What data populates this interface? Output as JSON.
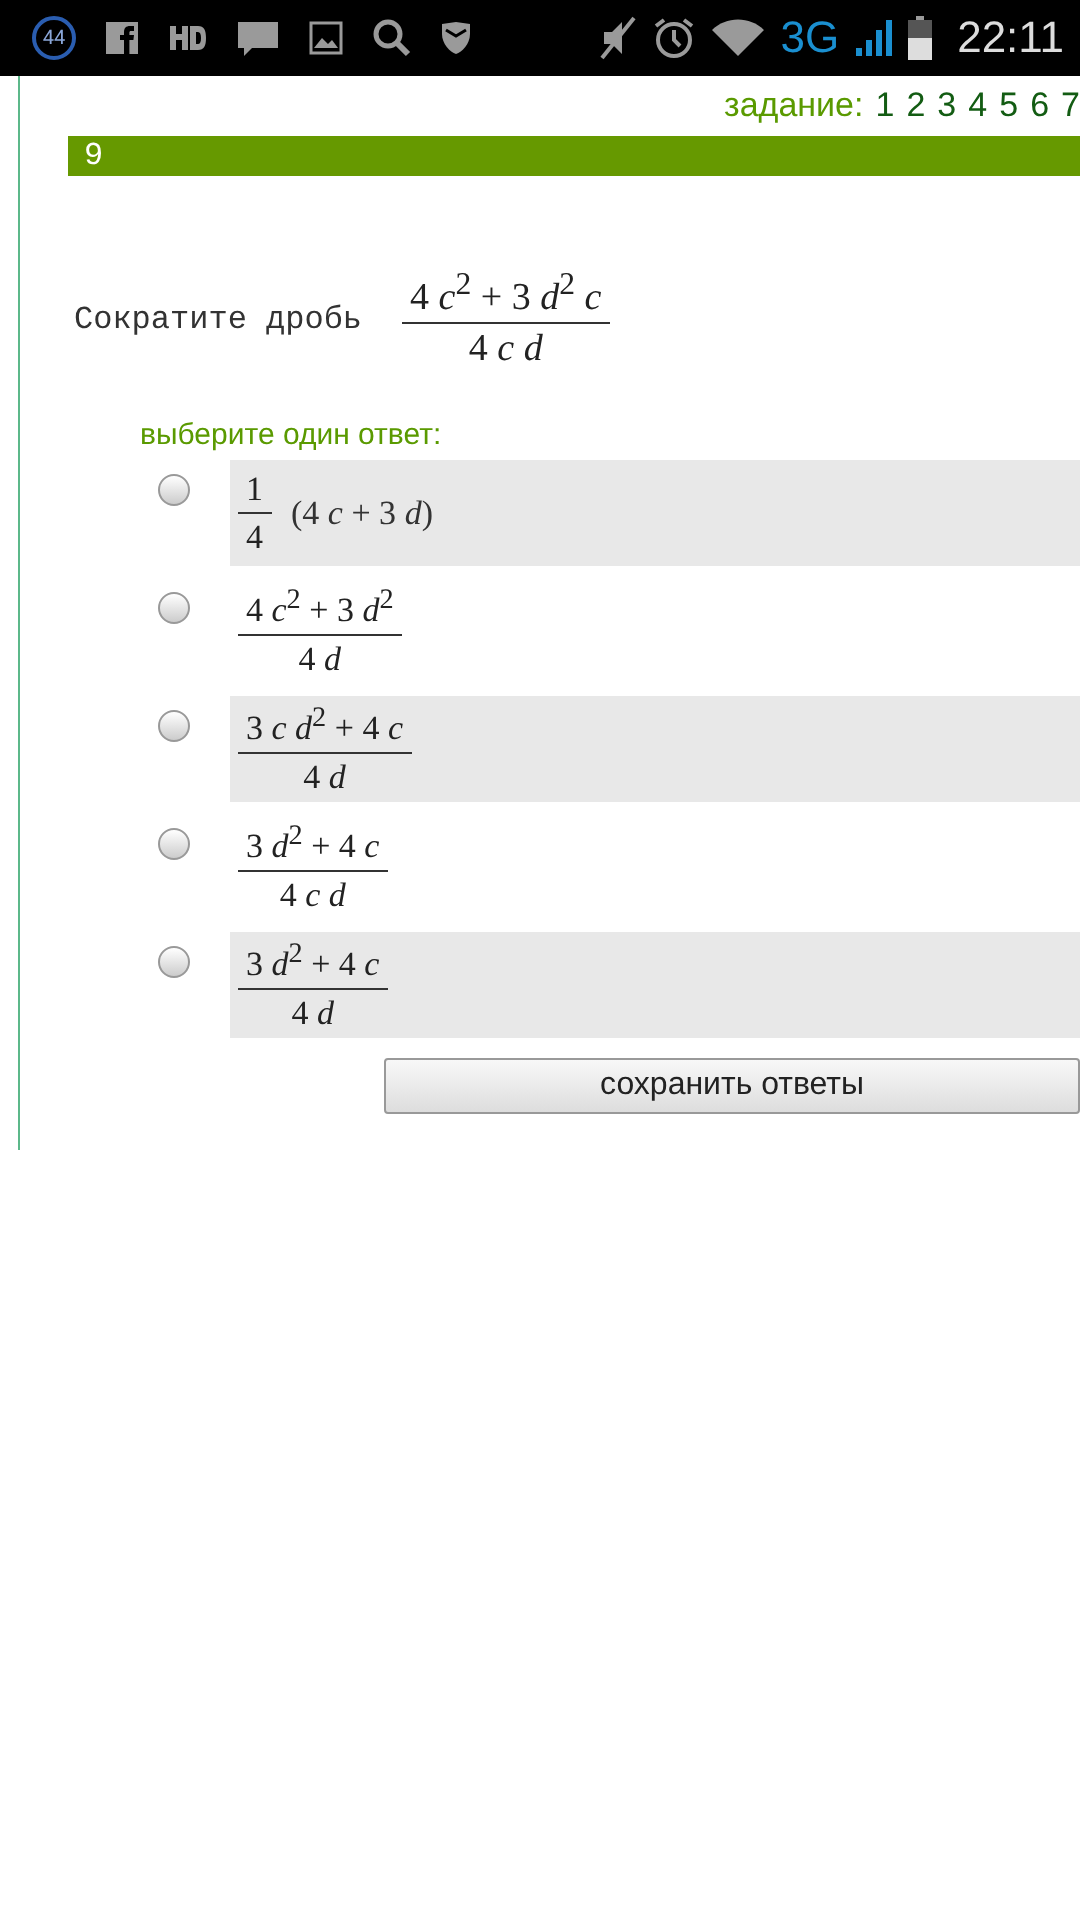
{
  "status_bar": {
    "notification_count": "44",
    "network": "3G",
    "time": "22:11"
  },
  "task_nav": {
    "label": "задание:",
    "items": [
      {
        "label": "1"
      },
      {
        "label": "2"
      },
      {
        "label": "3"
      },
      {
        "label": "4"
      },
      {
        "label": "5"
      },
      {
        "label": "6"
      },
      {
        "label": "7"
      }
    ]
  },
  "question_number": "9",
  "question": {
    "text": "Сократите дробь",
    "numerator": "4 *c*$^{2}$ + 3 *d*$^{2}$ *c*",
    "denominator": "4 *c* *d*"
  },
  "prompt": "выберите один ответ:",
  "options": [
    {
      "kind": "product",
      "numerator": "1",
      "denominator": "4",
      "factor": "(4 *c* + 3 *d*)",
      "selected": false
    },
    {
      "kind": "fraction",
      "numerator": "4 *c*$^{2}$ + 3 *d*$^{2}$",
      "denominator": "4 *d*",
      "selected": false
    },
    {
      "kind": "fraction",
      "numerator": "3 *c* *d*$^{2}$ + 4 *c*",
      "denominator": "4 *d*",
      "selected": false
    },
    {
      "kind": "fraction",
      "numerator": "3 *d*$^{2}$ + 4 *c*",
      "denominator": "4 *c* *d*",
      "selected": false
    },
    {
      "kind": "fraction",
      "numerator": "3 *d*$^{2}$ + 4 *c*",
      "denominator": "4 *d*",
      "selected": false
    }
  ],
  "save_button": "сохранить ответы"
}
